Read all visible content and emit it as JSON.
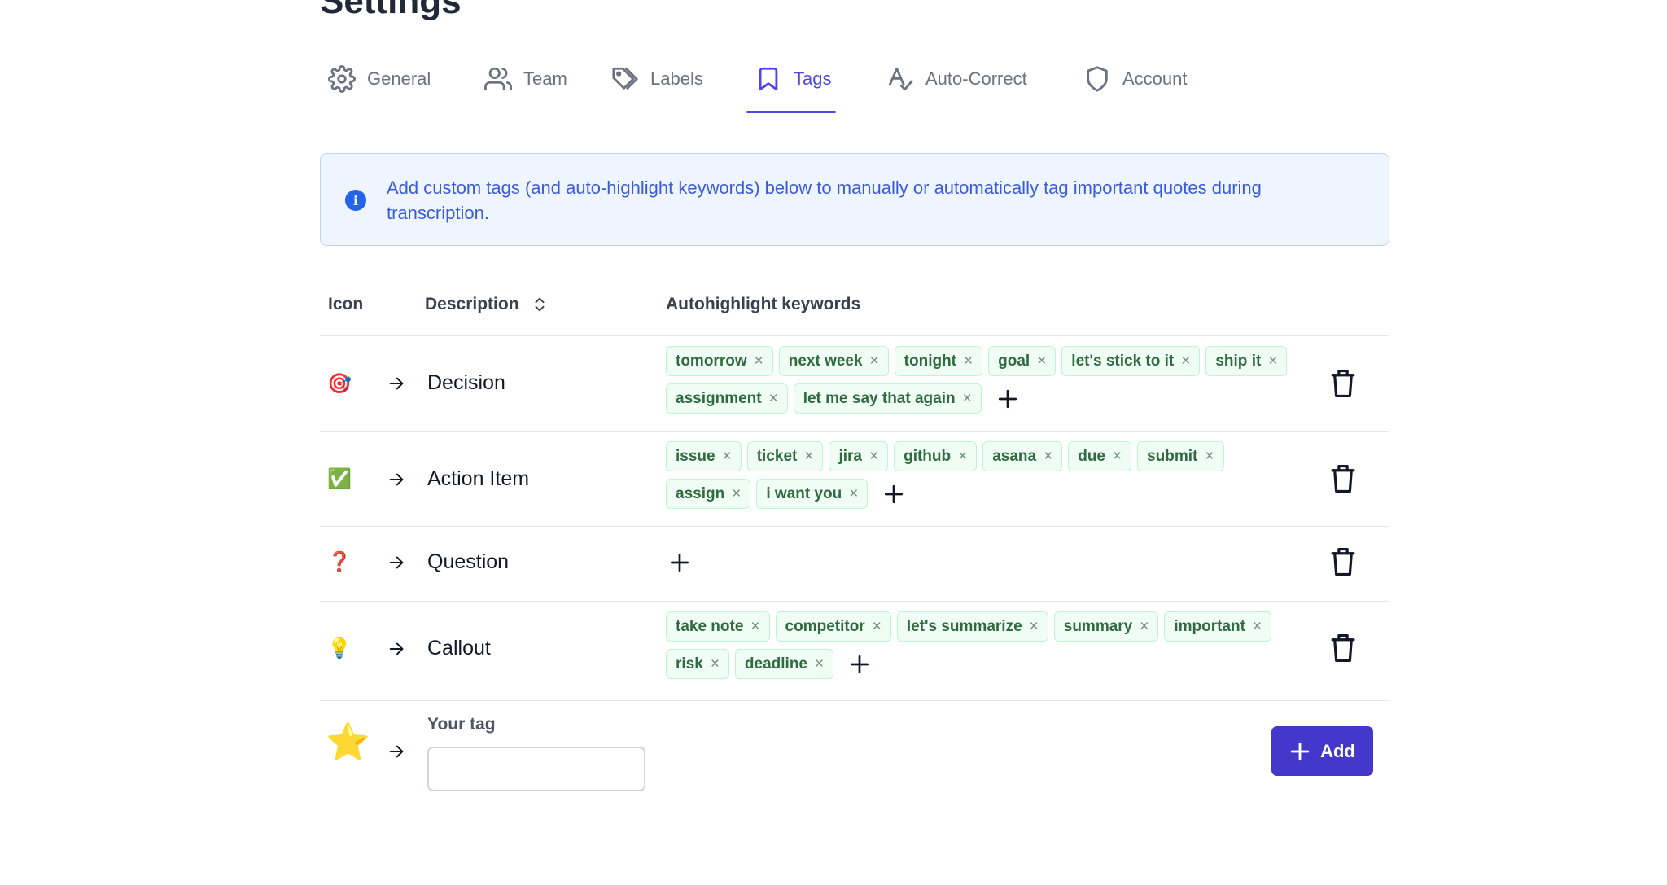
{
  "page": {
    "title": "Settings"
  },
  "tabs": [
    {
      "label": "General",
      "icon": "gear-icon"
    },
    {
      "label": "Team",
      "icon": "users-icon"
    },
    {
      "label": "Labels",
      "icon": "tags-icon"
    },
    {
      "label": "Tags",
      "icon": "bookmark-icon",
      "active": true
    },
    {
      "label": "Auto-Correct",
      "icon": "spellcheck-icon"
    },
    {
      "label": "Account",
      "icon": "shield-icon"
    }
  ],
  "info": {
    "icon": "info-icon",
    "text": "Add custom tags (and auto-highlight keywords) below to manually or automatically tag important quotes during transcription."
  },
  "table": {
    "headers": {
      "icon": "Icon",
      "description": "Description",
      "keywords": "Autohighlight keywords"
    },
    "rows": [
      {
        "emoji": "🎯",
        "description": "Decision",
        "keywords": [
          "tomorrow",
          "next week",
          "tonight",
          "goal",
          "let's stick to it",
          "ship it",
          "assignment",
          "let me say that again"
        ]
      },
      {
        "emoji": "✅",
        "description": "Action Item",
        "keywords": [
          "issue",
          "ticket",
          "jira",
          "github",
          "asana",
          "due",
          "submit",
          "assign",
          "i want you"
        ]
      },
      {
        "emoji": "❓",
        "description": "Question",
        "keywords": []
      },
      {
        "emoji": "💡",
        "description": "Callout",
        "keywords": [
          "take note",
          "competitor",
          "let's summarize",
          "summary",
          "important",
          "risk",
          "deadline"
        ]
      }
    ]
  },
  "new_tag": {
    "emoji": "⭐",
    "label": "Your tag",
    "value": "",
    "add_label": "Add"
  },
  "colors": {
    "accent": "#4f46e5",
    "add_button": "#4338ca",
    "info_bg": "#eef5fe",
    "info_text": "#3b5bdb",
    "chip_bg": "#f0fdf4",
    "chip_border": "#bbf7d0",
    "chip_text": "#2f6b3e"
  }
}
